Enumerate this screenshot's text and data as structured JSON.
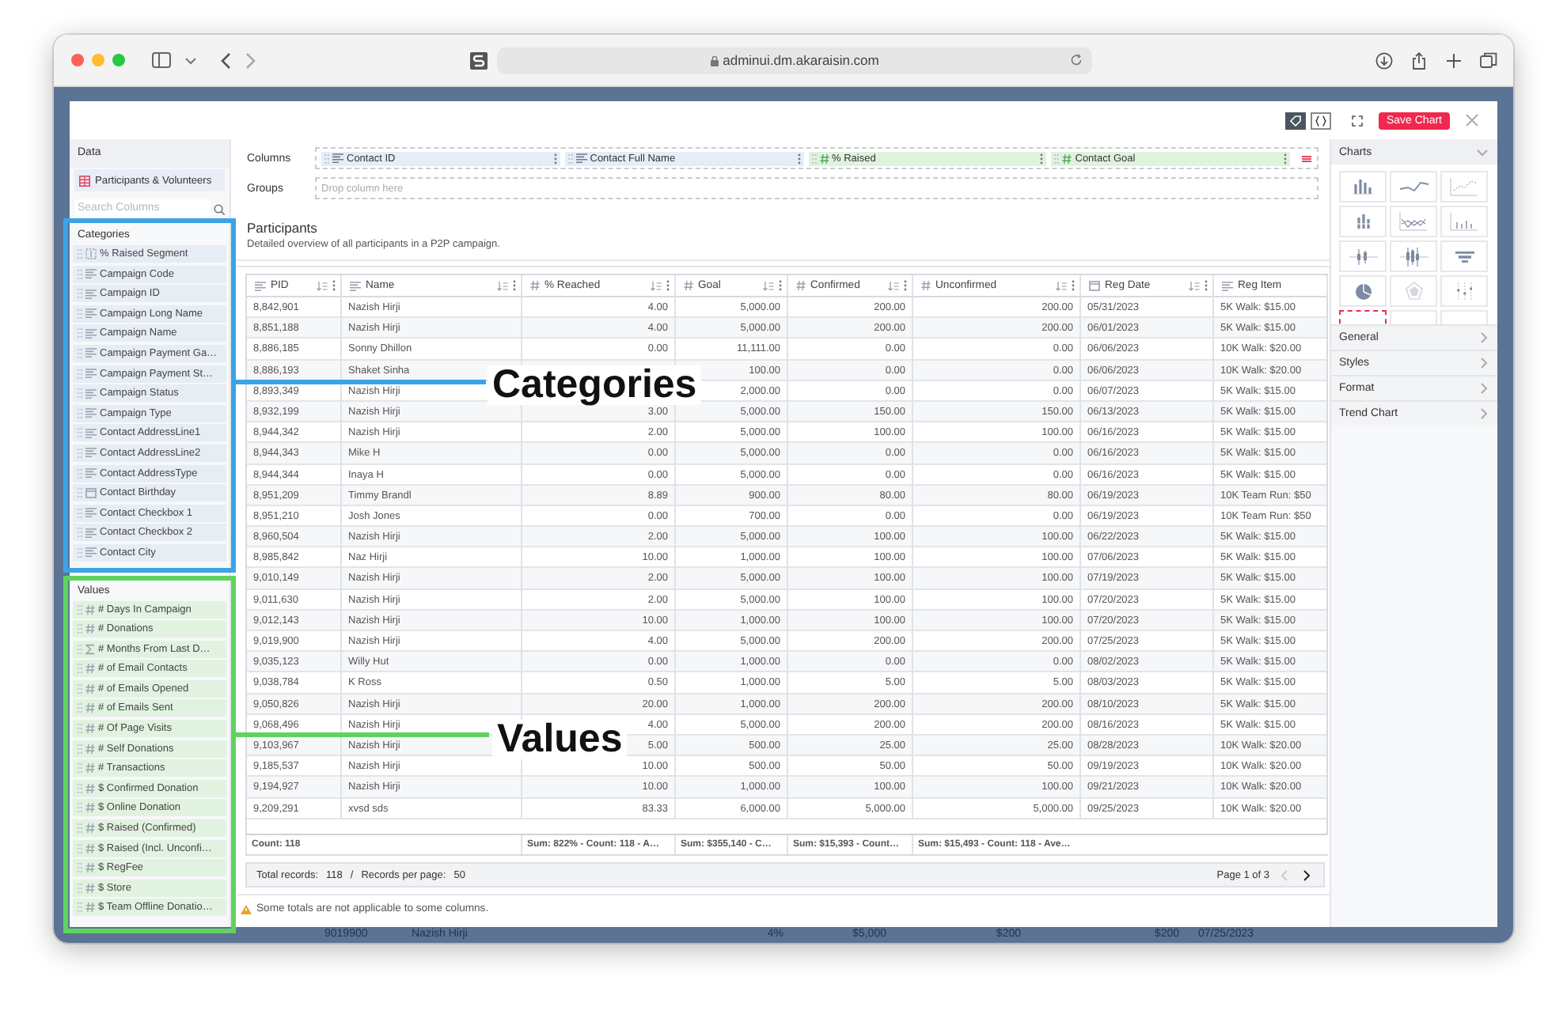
{
  "browser": {
    "url": "adminui.dm.akaraisin.com"
  },
  "toolbar": {
    "save_button": "Save Chart"
  },
  "data_panel": {
    "title": "Data",
    "source": "Participants & Volunteers",
    "search": {
      "placeholder": "Search Columns"
    },
    "sections": [
      {
        "kind": "categories",
        "title": "Categories",
        "items": [
          {
            "label": "% Raised Segment",
            "kind": "segment"
          },
          {
            "label": "Campaign Code",
            "kind": "text"
          },
          {
            "label": "Campaign ID",
            "kind": "text"
          },
          {
            "label": "Campaign Long Name",
            "kind": "text"
          },
          {
            "label": "Campaign Name",
            "kind": "text"
          },
          {
            "label": "Campaign Payment Ga…",
            "kind": "text"
          },
          {
            "label": "Campaign Payment St…",
            "kind": "text"
          },
          {
            "label": "Campaign Status",
            "kind": "text"
          },
          {
            "label": "Campaign Type",
            "kind": "text"
          },
          {
            "label": "Contact AddressLine1",
            "kind": "text"
          },
          {
            "label": "Contact AddressLine2",
            "kind": "text"
          },
          {
            "label": "Contact AddressType",
            "kind": "text"
          },
          {
            "label": "Contact Birthday",
            "kind": "date"
          },
          {
            "label": "Contact Checkbox 1",
            "kind": "text"
          },
          {
            "label": "Contact Checkbox 2",
            "kind": "text"
          },
          {
            "label": "Contact City",
            "kind": "text"
          }
        ]
      },
      {
        "kind": "values",
        "title": "Values",
        "items": [
          {
            "label": "# Days In Campaign",
            "kind": "number"
          },
          {
            "label": "# Donations",
            "kind": "number"
          },
          {
            "label": "# Months From Last D…",
            "kind": "calc"
          },
          {
            "label": "# of Email Contacts",
            "kind": "number"
          },
          {
            "label": "# of Emails Opened",
            "kind": "number"
          },
          {
            "label": "# of Emails Sent",
            "kind": "number"
          },
          {
            "label": "# Of Page Visits",
            "kind": "number"
          },
          {
            "label": "# Self Donations",
            "kind": "number"
          },
          {
            "label": "# Transactions",
            "kind": "number"
          },
          {
            "label": "$ Confirmed Donation",
            "kind": "number"
          },
          {
            "label": "$ Online Donation",
            "kind": "number"
          },
          {
            "label": "$ Raised (Confirmed)",
            "kind": "number"
          },
          {
            "label": "$ Raised (Incl. Unconfi…",
            "kind": "number"
          },
          {
            "label": "$ RegFee",
            "kind": "number"
          },
          {
            "label": "$ Store",
            "kind": "number"
          },
          {
            "label": "$ Team Offline Donatio…",
            "kind": "number"
          }
        ]
      }
    ]
  },
  "columns_shelf": {
    "label": "Columns",
    "chips": [
      {
        "label": "Contact ID",
        "kind": "dimension"
      },
      {
        "label": "Contact Full Name",
        "kind": "dimension"
      },
      {
        "label": "% Raised",
        "kind": "measure"
      },
      {
        "label": "Contact Goal",
        "kind": "measure"
      }
    ]
  },
  "groups_shelf": {
    "label": "Groups",
    "placeholder": "Drop column here"
  },
  "report": {
    "title": "Participants",
    "description": "Detailed overview of all participants in a P2P campaign.",
    "table": {
      "columns": [
        {
          "label": "PID",
          "kind": "text"
        },
        {
          "label": "Name",
          "kind": "text"
        },
        {
          "label": "% Reached",
          "kind": "number"
        },
        {
          "label": "Goal",
          "kind": "number"
        },
        {
          "label": "Confirmed",
          "kind": "number"
        },
        {
          "label": "Unconfirmed",
          "kind": "number"
        },
        {
          "label": "Reg Date",
          "kind": "date"
        },
        {
          "label": "Reg Item",
          "kind": "text"
        }
      ],
      "rows": [
        [
          "8,842,901",
          "Nazish Hirji",
          "4.00",
          "5,000.00",
          "200.00",
          "200.00",
          "05/31/2023",
          "5K Walk: $15.00"
        ],
        [
          "8,851,188",
          "Nazish Hirji",
          "4.00",
          "5,000.00",
          "200.00",
          "200.00",
          "06/01/2023",
          "5K Walk: $15.00"
        ],
        [
          "8,886,185",
          "Sonny Dhillon",
          "0.00",
          "11,111.00",
          "0.00",
          "0.00",
          "06/06/2023",
          "10K Walk: $20.00"
        ],
        [
          "8,886,193",
          "Shaket Sinha",
          null,
          "100.00",
          "0.00",
          "0.00",
          "06/06/2023",
          "10K Walk: $20.00"
        ],
        [
          "8,893,349",
          "Nazish Hirji",
          null,
          "2,000.00",
          "0.00",
          "0.00",
          "06/07/2023",
          "5K Walk: $15.00"
        ],
        [
          "8,932,199",
          "Nazish Hirji",
          "3.00",
          "5,000.00",
          "150.00",
          "150.00",
          "06/13/2023",
          "5K Walk: $15.00"
        ],
        [
          "8,944,342",
          "Nazish Hirji",
          "2.00",
          "5,000.00",
          "100.00",
          "100.00",
          "06/16/2023",
          "5K Walk: $15.00"
        ],
        [
          "8,944,343",
          "Mike H",
          "0.00",
          "5,000.00",
          "0.00",
          "0.00",
          "06/16/2023",
          "5K Walk: $15.00"
        ],
        [
          "8,944,344",
          "Inaya H",
          "0.00",
          "5,000.00",
          "0.00",
          "0.00",
          "06/16/2023",
          "5K Walk: $15.00"
        ],
        [
          "8,951,209",
          "Timmy Brandl",
          "8.89",
          "900.00",
          "80.00",
          "80.00",
          "06/19/2023",
          "10K Team Run: $50"
        ],
        [
          "8,951,210",
          "Josh Jones",
          "0.00",
          "700.00",
          "0.00",
          "0.00",
          "06/19/2023",
          "10K Team Run: $50"
        ],
        [
          "8,960,504",
          "Nazish Hirji",
          "2.00",
          "5,000.00",
          "100.00",
          "100.00",
          "06/22/2023",
          "5K Walk: $15.00"
        ],
        [
          "8,985,842",
          "Naz Hirji",
          "10.00",
          "1,000.00",
          "100.00",
          "100.00",
          "07/06/2023",
          "5K Walk: $15.00"
        ],
        [
          "9,010,149",
          "Nazish Hirji",
          "2.00",
          "5,000.00",
          "100.00",
          "100.00",
          "07/19/2023",
          "5K Walk: $15.00"
        ],
        [
          "9,011,630",
          "Nazish Hirji",
          "2.00",
          "5,000.00",
          "100.00",
          "100.00",
          "07/20/2023",
          "5K Walk: $15.00"
        ],
        [
          "9,012,143",
          "Nazish Hirji",
          "10.00",
          "1,000.00",
          "100.00",
          "100.00",
          "07/20/2023",
          "5K Walk: $15.00"
        ],
        [
          "9,019,900",
          "Nazish Hirji",
          "4.00",
          "5,000.00",
          "200.00",
          "200.00",
          "07/25/2023",
          "5K Walk: $15.00"
        ],
        [
          "9,035,123",
          "Willy Hut",
          "0.00",
          "1,000.00",
          "0.00",
          "0.00",
          "08/02/2023",
          "5K Walk: $15.00"
        ],
        [
          "9,038,784",
          "K Ross",
          "0.50",
          "1,000.00",
          "5.00",
          "5.00",
          "08/03/2023",
          "5K Walk: $15.00"
        ],
        [
          "9,050,826",
          "Nazish Hirji",
          "20.00",
          "1,000.00",
          "200.00",
          "200.00",
          "08/10/2023",
          "5K Walk: $15.00"
        ],
        [
          "9,068,496",
          "Nazish Hirji",
          "4.00",
          "5,000.00",
          "200.00",
          "200.00",
          "08/16/2023",
          "5K Walk: $15.00"
        ],
        [
          "9,103,967",
          "Nazish Hirji",
          "5.00",
          "500.00",
          "25.00",
          "25.00",
          "08/28/2023",
          "10K Walk: $20.00"
        ],
        [
          "9,185,537",
          "Nazish Hirji",
          "10.00",
          "500.00",
          "50.00",
          "50.00",
          "09/19/2023",
          "10K Walk: $20.00"
        ],
        [
          "9,194,927",
          "Nazish Hirji",
          "10.00",
          "1,000.00",
          "100.00",
          "100.00",
          "09/21/2023",
          "10K Walk: $20.00"
        ],
        [
          "9,209,291",
          "xvsd sds",
          "83.33",
          "6,000.00",
          "5,000.00",
          "5,000.00",
          "09/25/2023",
          "10K Walk: $20.00"
        ]
      ],
      "totals": {
        "pid": "Count: 118",
        "percent_reached": "Sum: 822% - Count: 118 - A…",
        "goal": "Sum: $355,140 - C…",
        "confirmed": "Sum: $15,393 - Count…",
        "unconfirmed": "Sum: $15,493 - Count: 118 - Ave…"
      }
    },
    "pagination": {
      "total_label": "Total records:",
      "total": "118",
      "separator": "/",
      "per_page_label": "Records per page:",
      "per_page": "50",
      "page": "Page 1 of 3",
      "prev_disabled": true
    },
    "warning": "Some totals are not applicable to some columns."
  },
  "charts_panel": {
    "title": "Charts",
    "chart_types": [
      {
        "kind": "bar",
        "selected": false
      },
      {
        "kind": "line",
        "selected": false
      },
      {
        "kind": "scatter",
        "selected": false
      },
      {
        "kind": "stacked-bar",
        "selected": false
      },
      {
        "kind": "multi-line",
        "selected": false
      },
      {
        "kind": "column-dots",
        "selected": false
      },
      {
        "kind": "candle",
        "selected": false
      },
      {
        "kind": "candle-double",
        "selected": false
      },
      {
        "kind": "funnel",
        "selected": false
      },
      {
        "kind": "pie",
        "selected": false
      },
      {
        "kind": "radar",
        "selected": false
      },
      {
        "kind": "strip",
        "selected": false
      },
      {
        "kind": "table",
        "selected": true
      },
      {
        "kind": "bullet",
        "selected": false
      },
      {
        "kind": "blank",
        "selected": false
      }
    ],
    "sections": [
      "General",
      "Styles",
      "Format",
      "Trend Chart"
    ]
  },
  "background_row": [
    "9019900",
    "Nazish Hirji",
    "4%",
    "$5,000",
    "$200",
    "$200",
    "07/25/2023"
  ],
  "annotations": [
    {
      "kind": "categories",
      "label": "Categories"
    },
    {
      "kind": "values",
      "label": "Values"
    }
  ]
}
